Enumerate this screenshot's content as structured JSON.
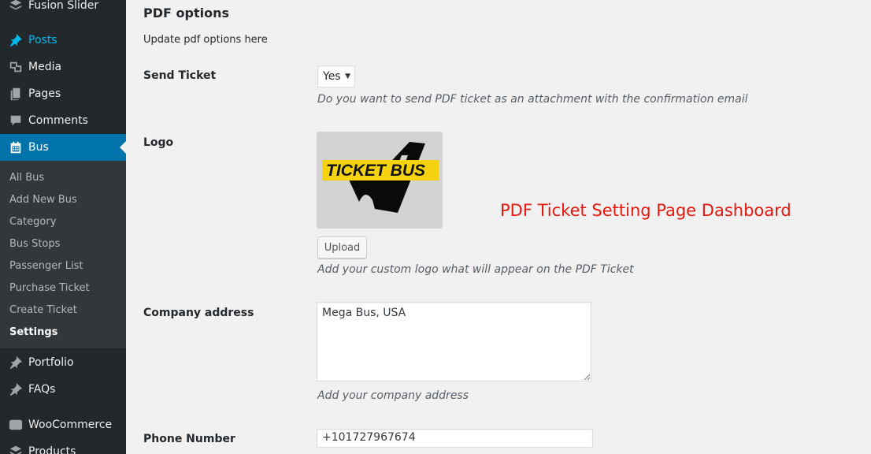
{
  "sidebar": {
    "top_items": [
      {
        "label": "Fusion Slider",
        "icon": "layers-icon"
      },
      {
        "label": "Posts",
        "icon": "pin-icon"
      },
      {
        "label": "Media",
        "icon": "media-icon"
      },
      {
        "label": "Pages",
        "icon": "pages-icon"
      },
      {
        "label": "Comments",
        "icon": "comment-icon"
      },
      {
        "label": "Bus",
        "icon": "calendar-icon"
      }
    ],
    "submenu": [
      "All Bus",
      "Add New Bus",
      "Category",
      "Bus Stops",
      "Passenger List",
      "Purchase Ticket",
      "Create Ticket",
      "Settings"
    ],
    "bottom_items": [
      {
        "label": "Portfolio",
        "icon": "pin-icon"
      },
      {
        "label": "FAQs",
        "icon": "pin-icon"
      },
      {
        "label": "WooCommerce",
        "icon": "woo-icon"
      },
      {
        "label": "Products",
        "icon": "products-icon"
      }
    ]
  },
  "main": {
    "title": "PDF options",
    "description": "Update pdf options here",
    "send_ticket": {
      "label": "Send Ticket",
      "value": "Yes",
      "help": "Do you want to send PDF ticket as an attachment with the confirmation email"
    },
    "logo": {
      "label": "Logo",
      "image_text": "TICKET BUS",
      "upload_label": "Upload",
      "help": "Add your custom logo what will appear on the PDF Ticket"
    },
    "company_address": {
      "label": "Company address",
      "value": "Mega Bus, USA",
      "help": "Add your company address"
    },
    "phone": {
      "label": "Phone Number",
      "value": "+101727967674"
    },
    "overlay_caption": "PDF Ticket Setting Page Dashboard"
  },
  "colors": {
    "sidebar_bg": "#23282d",
    "submenu_bg": "#32373c",
    "accent": "#0073aa",
    "highlight": "#00b9eb",
    "caption_red": "#e8170d"
  }
}
